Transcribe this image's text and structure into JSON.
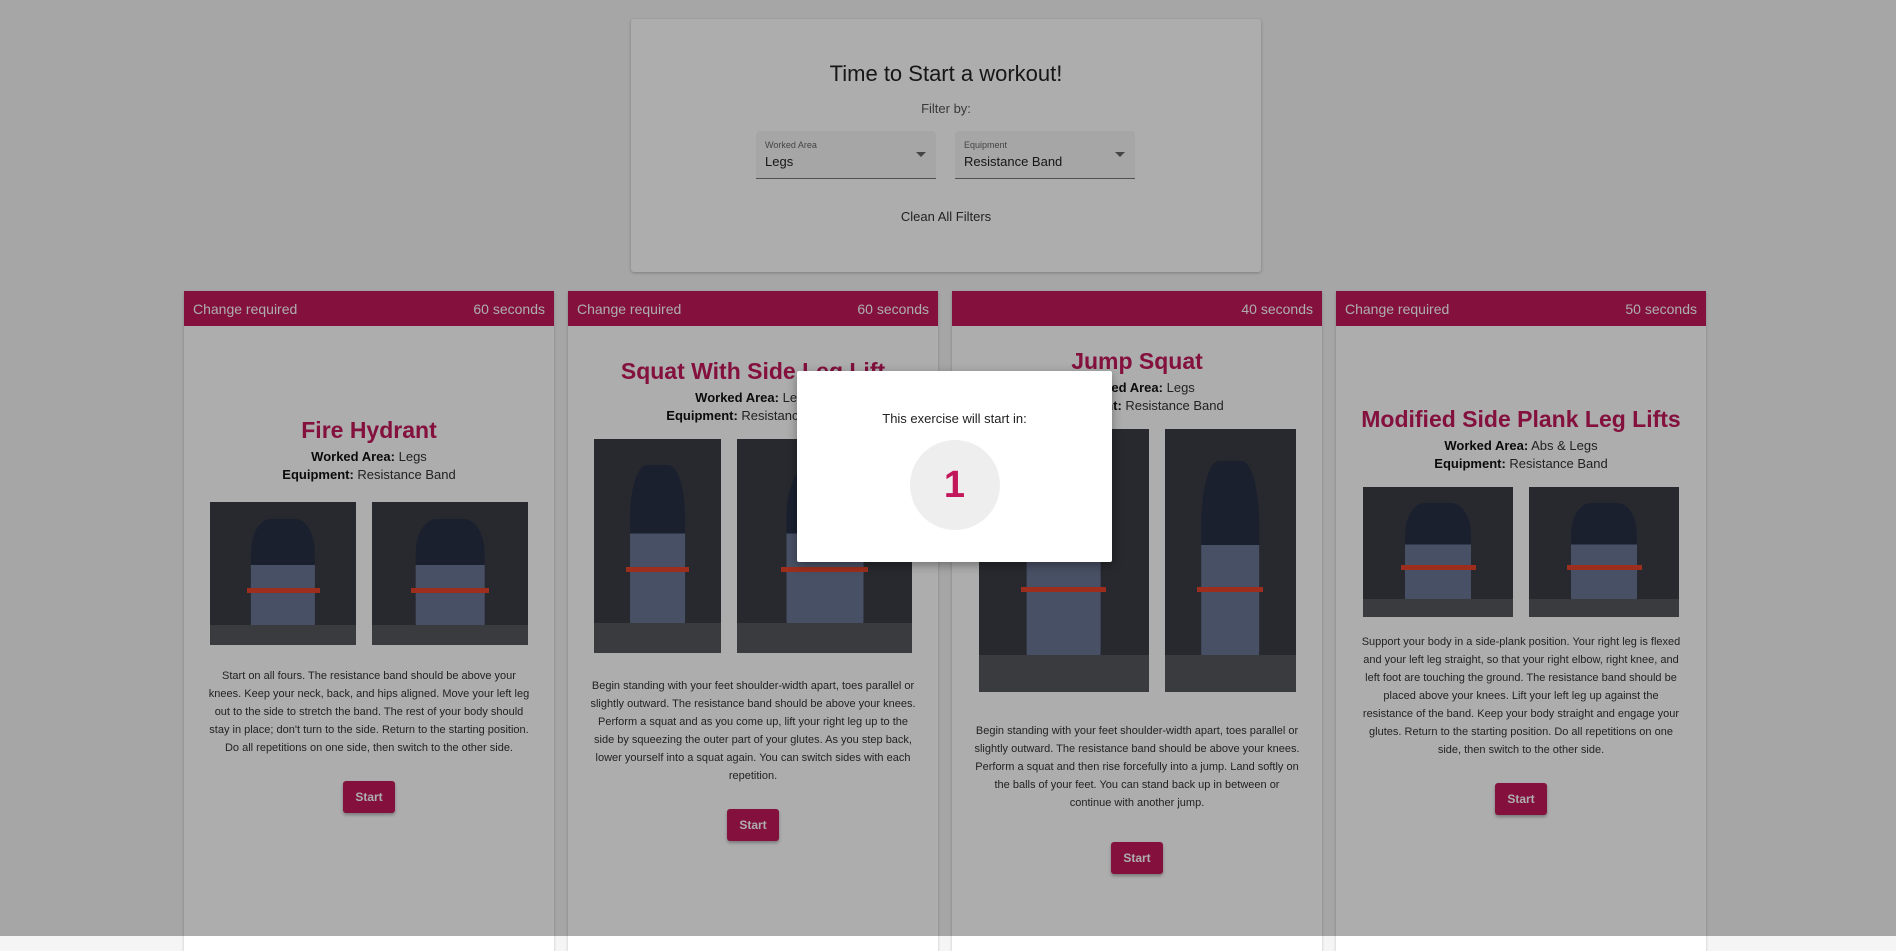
{
  "filter": {
    "title": "Time to Start a workout!",
    "subtitle": "Filter by:",
    "worked_area_label": "Worked Area",
    "worked_area_value": "Legs",
    "equipment_label": "Equipment",
    "equipment_value": "Resistance Band",
    "clean_label": "Clean All Filters"
  },
  "labels": {
    "worked_area": "Worked Area:",
    "equipment": "Equipment:"
  },
  "cards": [
    {
      "header_left": "Change required",
      "header_right": "60 seconds",
      "title": "Fire Hydrant",
      "worked_area": "Legs",
      "equipment": "Resistance Band",
      "description": "Start on all fours. The resistance band should be above your knees. Keep your neck, back, and hips aligned. Move your left leg out to the side to stretch the band. The rest of your body should stay in place; don't turn to the side. Return to the starting position. Do all repetitions on one side, then switch to the other side.",
      "start_label": "Start"
    },
    {
      "header_left": "Change required",
      "header_right": "60 seconds",
      "title": "Squat With Side Leg Lift",
      "worked_area": "Legs",
      "equipment": "Resistance Band",
      "description": "Begin standing with your feet shoulder-width apart, toes parallel or slightly outward. The resistance band should be above your knees. Perform a squat and as you come up, lift your right leg up to the side by squeezing the outer part of your glutes. As you step back, lower yourself into a squat again. You can switch sides with each repetition.",
      "start_label": "Start"
    },
    {
      "header_left": "",
      "header_right": "40 seconds",
      "title": "Jump Squat",
      "worked_area": "Legs",
      "equipment": "Resistance Band",
      "description": "Begin standing with your feet shoulder-width apart, toes parallel or slightly outward. The resistance band should be above your knees. Perform a squat and then rise forcefully into a jump. Land softly on the balls of your feet. You can stand back up in between or continue with another jump.",
      "start_label": "Start"
    },
    {
      "header_left": "Change required",
      "header_right": "50 seconds",
      "title": "Modified Side Plank Leg Lifts",
      "worked_area": "Abs & Legs",
      "equipment": "Resistance Band",
      "description": "Support your body in a side-plank position. Your right leg is flexed and your left leg straight, so that your right elbow, right knee, and left foot are touching the ground. The resistance band should be placed above your knees. Lift your left leg up against the resistance of the band. Keep your body straight and engage your glutes. Return to the starting position. Do all repetitions on one side, then switch to the other side.",
      "start_label": "Start"
    }
  ],
  "modal": {
    "text": "This exercise will start in:",
    "count": "1"
  }
}
